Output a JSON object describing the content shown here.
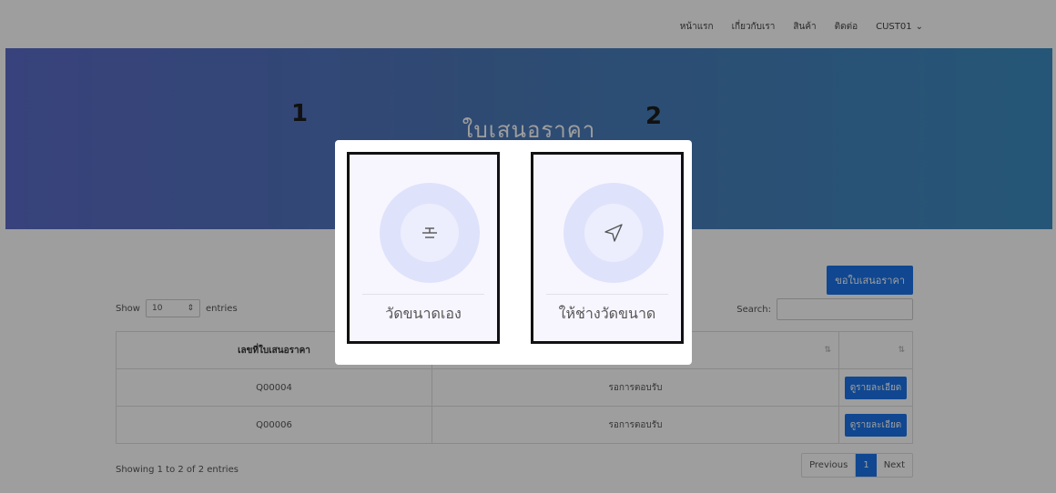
{
  "nav": {
    "items": [
      "หน้าแรก",
      "เกี่ยวกับเรา",
      "สินค้า",
      "ติดต่อ"
    ],
    "user": "CUST01",
    "user_caret": "⌄"
  },
  "hero": {
    "title": "ใบเสนอราคา"
  },
  "toolbar": {
    "request_quote_label": "ขอใบเสนอราคา"
  },
  "table_controls": {
    "show_label": "Show",
    "show_value": "10",
    "entries_label": "entries",
    "search_label": "Search:",
    "search_value": ""
  },
  "table": {
    "headers": [
      "เลขที่ใบเสนอราคา",
      "",
      ""
    ],
    "sort_icon": "⇅",
    "rows": [
      {
        "number": "Q00004",
        "status": "รอการตอบรับ",
        "action": "ดูรายละเอียด"
      },
      {
        "number": "Q00006",
        "status": "รอการตอบรับ",
        "action": "ดูรายละเอียด"
      }
    ]
  },
  "footer": {
    "showing": "Showing 1 to 2 of 2 entries",
    "prev": "Previous",
    "page": "1",
    "next": "Next"
  },
  "annotations": {
    "one": "1",
    "two": "2"
  },
  "modal": {
    "options": [
      {
        "label": "วัดขนาดเอง",
        "icon": "ruler-measure-icon"
      },
      {
        "label": "ให้ช่างวัดขนาด",
        "icon": "send-arrow-icon"
      }
    ]
  },
  "colors": {
    "accent": "#1a73e8",
    "hero_start": "#5b6bc8",
    "hero_end": "#3d8cc0"
  }
}
